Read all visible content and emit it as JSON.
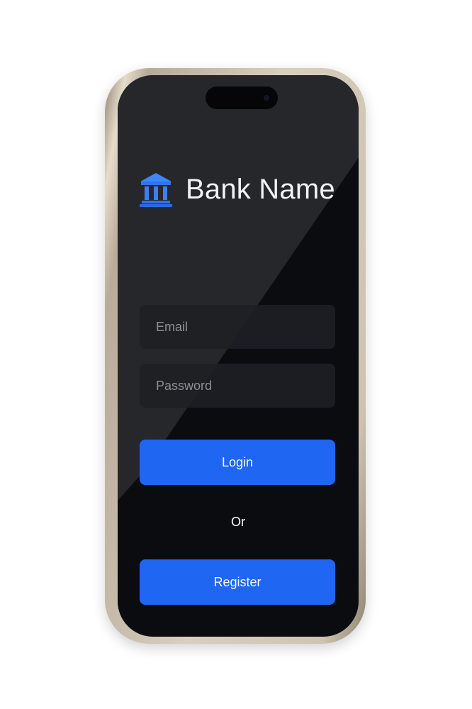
{
  "app": {
    "bank_name": "Bank Name",
    "icon": "bank-building-icon"
  },
  "form": {
    "email_placeholder": "Email",
    "email_value": "",
    "password_placeholder": "Password",
    "password_value": ""
  },
  "actions": {
    "login_label": "Login",
    "divider_label": "Or",
    "register_label": "Register"
  },
  "colors": {
    "accent": "#1f66f2",
    "screen_background": "#0b0c10",
    "input_background": "#1e1f24",
    "frame": "#d9cfbf"
  }
}
